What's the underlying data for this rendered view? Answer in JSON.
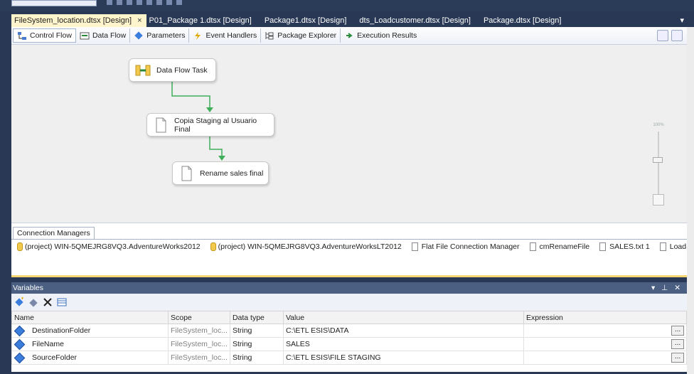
{
  "tabs": [
    {
      "label": "FileSystem_location.dtsx [Design]",
      "active": true
    },
    {
      "label": "P01_Package 1.dtsx [Design]"
    },
    {
      "label": "Package1.dtsx [Design]"
    },
    {
      "label": "dts_Loadcustomer.dtsx [Design]"
    },
    {
      "label": "Package.dtsx [Design]"
    }
  ],
  "tab_close": "×",
  "tab_overflow": "▾",
  "designer_tabs": [
    {
      "label": "Control Flow",
      "icon": "control-flow-icon"
    },
    {
      "label": "Data Flow",
      "icon": "data-flow-icon"
    },
    {
      "label": "Parameters",
      "icon": "parameters-icon"
    },
    {
      "label": "Event Handlers",
      "icon": "event-handlers-icon"
    },
    {
      "label": "Package Explorer",
      "icon": "package-explorer-icon"
    },
    {
      "label": "Execution Results",
      "icon": "execution-results-icon"
    }
  ],
  "tasks": [
    {
      "label": "Data Flow Task",
      "icon": "data-flow-task-icon"
    },
    {
      "label": "Copia Staging al Usuario Final",
      "icon": "file-system-task-icon"
    },
    {
      "label": "Rename sales final",
      "icon": "file-system-task-icon"
    }
  ],
  "zoom": {
    "label": "100%"
  },
  "connection_managers": {
    "tab_label": "Connection Managers",
    "items": [
      {
        "label": "(project) WIN-5QMEJRG8VQ3.AdventureWorks2012",
        "icon": "database-icon"
      },
      {
        "label": "(project) WIN-5QMEJRG8VQ3.AdventureWorksLT2012",
        "icon": "database-icon"
      },
      {
        "label": "Flat File Connection Manager",
        "icon": "flat-file-icon"
      },
      {
        "label": "cmRenameFile",
        "icon": "file-icon"
      },
      {
        "label": "SALES.txt 1",
        "icon": "flat-file-icon"
      },
      {
        "label": "LoadSales",
        "icon": "flat-file-icon"
      }
    ]
  },
  "variables": {
    "title": "Variables",
    "controls": "▾ ⊥ ✕",
    "columns": [
      "Name",
      "Scope",
      "Data type",
      "Value",
      "Expression"
    ],
    "rows": [
      {
        "name": "DestinationFolder",
        "scope": "FileSystem_loc...",
        "type": "String",
        "value": "C:\\ETL ESIS\\DATA",
        "expression": ""
      },
      {
        "name": "FileName",
        "scope": "FileSystem_loc...",
        "type": "String",
        "value": "SALES",
        "expression": ""
      },
      {
        "name": "SourceFolder",
        "scope": "FileSystem_loc...",
        "type": "String",
        "value": "C:\\ETL ESIS\\FILE STAGING",
        "expression": ""
      }
    ],
    "ellipsis": "..."
  },
  "colors": {
    "chrome": "#293955",
    "active_tab": "#fff5cc",
    "connector": "#3fae5a",
    "canvas": "#efefef"
  }
}
